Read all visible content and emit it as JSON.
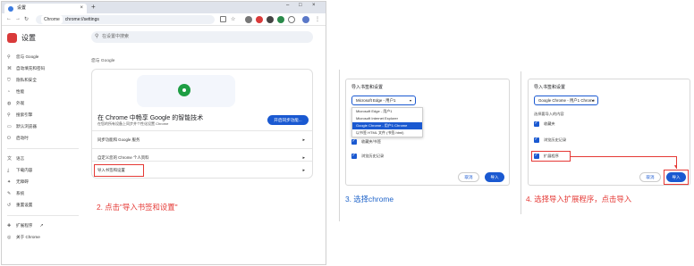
{
  "browser": {
    "tab_title": "设置",
    "url": "chrome://settings",
    "omnibox_chip": "Chrome"
  },
  "settings": {
    "title": "设置",
    "search_placeholder": "在设置中搜索",
    "sidebar": [
      {
        "icon": "person-icon",
        "label": "您与 Google"
      },
      {
        "icon": "autofill-icon",
        "label": "自动填充和密码"
      },
      {
        "icon": "shield-icon",
        "label": "隐私和安全"
      },
      {
        "icon": "speed-icon",
        "label": "性能"
      },
      {
        "icon": "palette-icon",
        "label": "外观"
      },
      {
        "icon": "magnifier-icon",
        "label": "搜索引擎"
      },
      {
        "icon": "browser-icon",
        "label": "默认浏览器"
      },
      {
        "icon": "power-icon",
        "label": "启动时"
      },
      {
        "icon": "language-icon",
        "label": "语言"
      },
      {
        "icon": "download-icon",
        "label": "下载内容"
      },
      {
        "icon": "accessibility-icon",
        "label": "无障碍"
      },
      {
        "icon": "wrench-icon",
        "label": "系统"
      },
      {
        "icon": "reset-icon",
        "label": "重置设置"
      },
      {
        "icon": "puzzle-icon",
        "label": "扩展程序"
      },
      {
        "icon": "chrome-icon",
        "label": "关于 Chrome"
      }
    ],
    "section_label": "您与 Google",
    "headline": "在 Chrome 中畅享 Google 的智能技术",
    "subline": "在您的所有设备上同步并个性化设置 Chrome",
    "signin_button": "开启同步功能...",
    "rows": [
      "同步功能和 Google 服务",
      "自定义您的 Chrome 个人资料",
      "导入书签和设置"
    ]
  },
  "step2": {
    "caption": "2. 点击\"导入书签和设置\""
  },
  "step3": {
    "dialog_title": "导入书签和设置",
    "selected": "Microsoft Edge - 用户1",
    "options": [
      "Microsoft Edge - 用户1",
      "Microsoft Internet Explorer",
      "Google Chrome - 用户1 Chrome",
      "以书签 HTML 文件 (书签.html)"
    ],
    "checks": [
      "收藏夹/书签",
      "浏览历史记录"
    ],
    "cancel": "取消",
    "import": "导入",
    "caption": "3. 选择chrome"
  },
  "step4": {
    "dialog_title": "导入书签和设置",
    "selected": "Google Chrome - 用户1 Chrome",
    "choose_label": "选择要导入的内容",
    "checks": [
      "收藏夹",
      "浏览历史记录",
      "扩展程序"
    ],
    "cancel": "取消",
    "import": "导入",
    "caption": "4. 选择导入扩展程序，点击导入"
  },
  "colors": {
    "accent": "#1a59d1",
    "annotation_red": "#e53935",
    "step_blue": "#1e63c9"
  }
}
